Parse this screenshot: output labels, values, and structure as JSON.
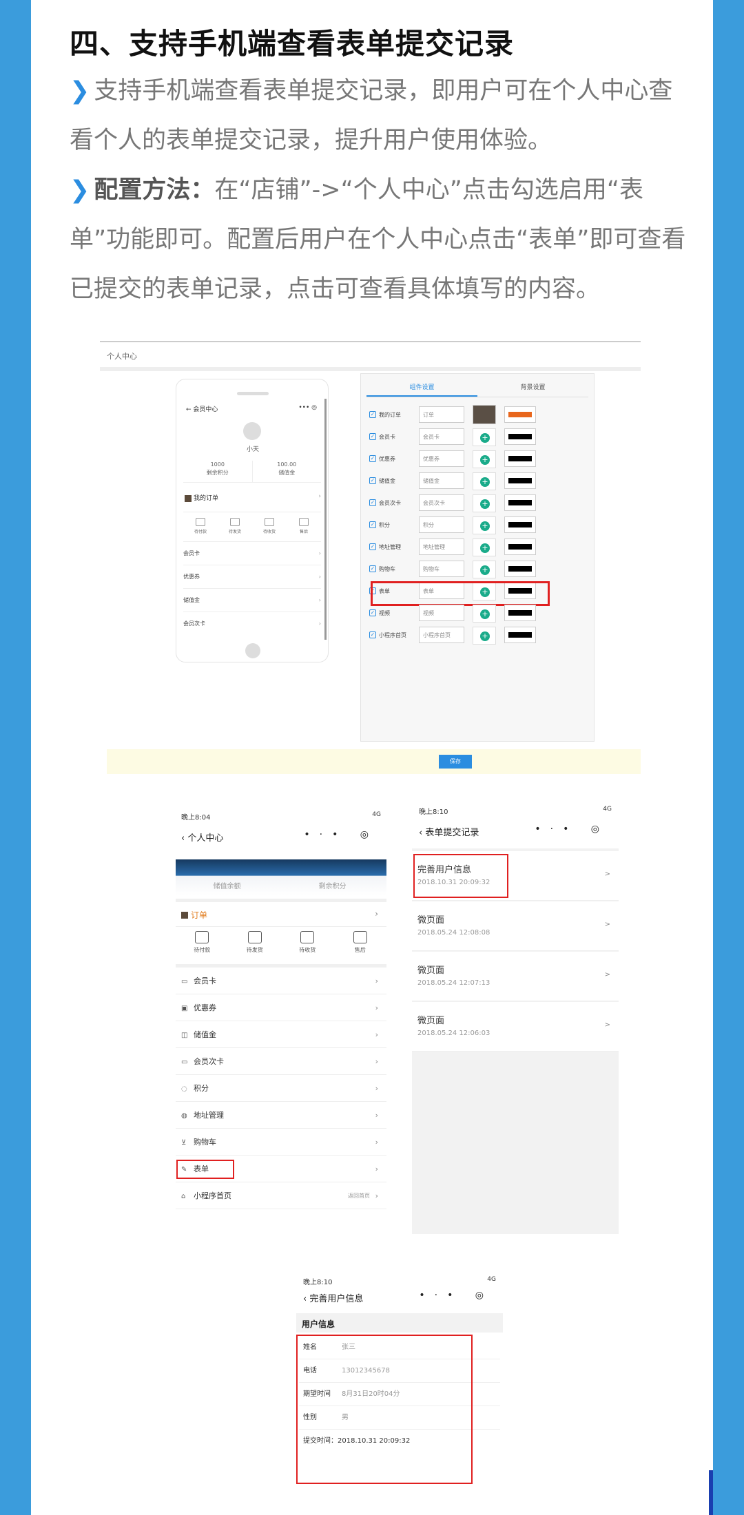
{
  "title": "四、支持手机端查看表单提交记录",
  "para1": {
    "marker": "❯",
    "text": "支持手机端查看表单提交记录，即用户可在个人中心查看个人的表单提交记录，提升用户使用体验。"
  },
  "para2": {
    "marker": "❯",
    "label": "配置方法：",
    "text": "在“店铺”->“个人中心”点击勾选启用“表单”功能即可。配置后用户在个人中心点击“表单”即可查看已提交的表单记录，点击可查看具体填写的内容。"
  },
  "admin": {
    "top_label": "个人中心",
    "phone": {
      "nav_title": "会员中心",
      "nav_icons": "••• ◎",
      "back": "←",
      "name": "小天",
      "stats": [
        {
          "value": "1000",
          "label": "剩余积分"
        },
        {
          "value": "100.00",
          "label": "储值金"
        }
      ],
      "order_label": "我的订单",
      "order_icons": [
        "待付款",
        "待发货",
        "待收货",
        "售后"
      ],
      "rows": [
        "会员卡",
        "优惠券",
        "储值金",
        "会员次卡"
      ],
      "chevron": "›"
    },
    "config": {
      "tabs": [
        "组件设置",
        "背景设置"
      ],
      "rows": [
        {
          "label": "我的订单",
          "value": "订单"
        },
        {
          "label": "会员卡",
          "value": "会员卡"
        },
        {
          "label": "优惠券",
          "value": "优惠券"
        },
        {
          "label": "储值金",
          "value": "储值金"
        },
        {
          "label": "会员次卡",
          "value": "会员次卡"
        },
        {
          "label": "积分",
          "value": "积分"
        },
        {
          "label": "地址管理",
          "value": "地址管理"
        },
        {
          "label": "购物车",
          "value": "购物车"
        },
        {
          "label": "表单",
          "value": "表单"
        },
        {
          "label": "视频",
          "value": "视频"
        },
        {
          "label": "小程序首页",
          "value": "小程序首页"
        }
      ],
      "check": "✓",
      "plus": "+",
      "colors": {
        "first": "#e8661c",
        "rest": "#000000",
        "highlight": "#e02020"
      }
    },
    "save_label": "保存"
  },
  "screen1": {
    "time": "晚上8:04",
    "signal": "4G",
    "back": "‹",
    "title": "个人中心",
    "nav_icons": "•·• ◎",
    "banner_labels": [
      "储值余额",
      "剩余积分"
    ],
    "order_label": "订单",
    "order_icons": [
      "待付款",
      "待发货",
      "待收货",
      "售后"
    ],
    "items": [
      {
        "glyph": "▭",
        "label": "会员卡"
      },
      {
        "glyph": "▣",
        "label": "优惠券"
      },
      {
        "glyph": "◫",
        "label": "储值金"
      },
      {
        "glyph": "▭",
        "label": "会员次卡"
      },
      {
        "glyph": "◌",
        "label": "积分"
      },
      {
        "glyph": "◍",
        "label": "地址管理"
      },
      {
        "glyph": "⊻",
        "label": "购物车"
      },
      {
        "glyph": "✎",
        "label": "表单"
      },
      {
        "glyph": "⌂",
        "label": "小程序首页"
      }
    ],
    "home_hint": "返回首页",
    "chevron": "›"
  },
  "screen2": {
    "time": "晚上8:10",
    "signal": "4G",
    "back": "‹",
    "title": "表单提交记录",
    "nav_icons": "•·• ◎",
    "records": [
      {
        "title": "完善用户信息",
        "date": "2018.10.31 20:09:32"
      },
      {
        "title": "微页面",
        "date": "2018.05.24 12:08:08"
      },
      {
        "title": "微页面",
        "date": "2018.05.24 12:07:13"
      },
      {
        "title": "微页面",
        "date": "2018.05.24 12:06:03"
      }
    ],
    "chevron": ">"
  },
  "screen3": {
    "time": "晚上8:10",
    "signal": "4G",
    "back": "‹",
    "title": "完善用户信息",
    "nav_icons": "•·• ◎",
    "section": "用户信息",
    "fields": [
      {
        "key": "姓名",
        "value": "张三"
      },
      {
        "key": "电话",
        "value": "13012345678"
      },
      {
        "key": "期望时间",
        "value": "8月31日20时04分"
      },
      {
        "key": "性别",
        "value": "男"
      }
    ],
    "submit_time": "提交时间：2018.10.31 20:09:32"
  }
}
